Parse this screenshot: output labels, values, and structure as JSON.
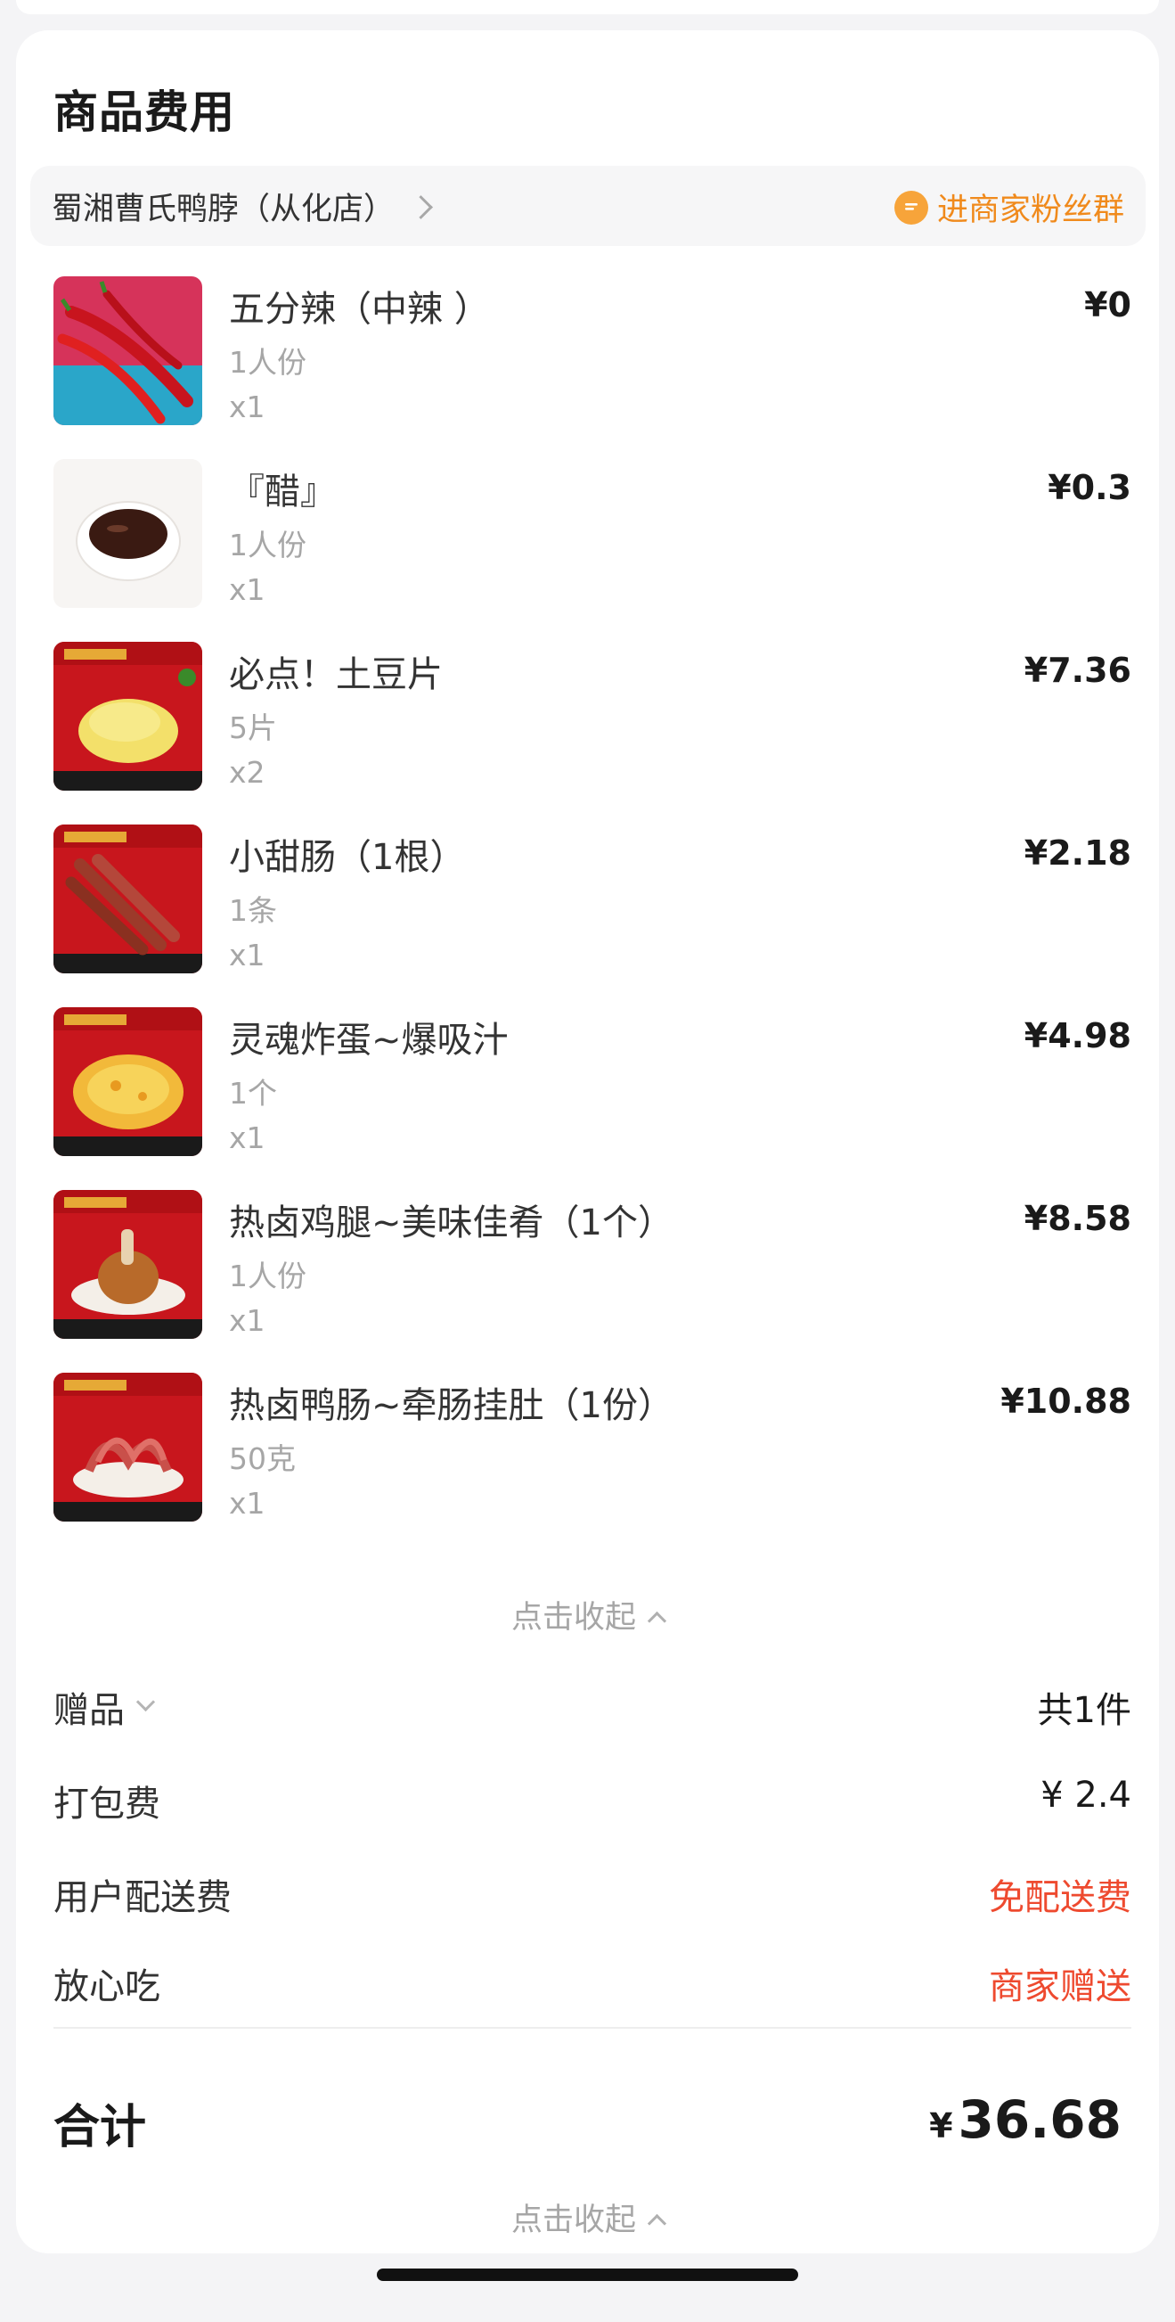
{
  "section": {
    "title": "商品费用"
  },
  "shop": {
    "name": "蜀湘曹氏鸭脖（从化店）",
    "fan_group_label": "进商家粉丝群",
    "fan_group_icon": "chat-bubble-icon",
    "accent_color": "#f08a1c"
  },
  "items": [
    {
      "name": "五分辣（中辣 ）",
      "spec": "1人份",
      "qty": "x1",
      "price": "¥0",
      "image": "chili-peppers"
    },
    {
      "name": "『醋』",
      "spec": "1人份",
      "qty": "x1",
      "price": "¥0.3",
      "image": "vinegar-dish"
    },
    {
      "name": "必点！土豆片",
      "spec": "5片",
      "qty": "x2",
      "price": "¥7.36",
      "image": "potato-slices"
    },
    {
      "name": "小甜肠（1根）",
      "spec": "1条",
      "qty": "x1",
      "price": "¥2.18",
      "image": "sausage"
    },
    {
      "name": "灵魂炸蛋~爆吸汁",
      "spec": "1个",
      "qty": "x1",
      "price": "¥4.98",
      "image": "fried-egg"
    },
    {
      "name": "热卤鸡腿~美味佳肴（1个）",
      "spec": "1人份",
      "qty": "x1",
      "price": "¥8.58",
      "image": "chicken-leg"
    },
    {
      "name": "热卤鸭肠~牵肠挂肚（1份）",
      "spec": "50克",
      "qty": "x1",
      "price": "¥10.88",
      "image": "duck-intestine"
    }
  ],
  "collapse_label": "点击收起",
  "fees": {
    "gift": {
      "label": "赠品",
      "value": "共1件"
    },
    "packing": {
      "label": "打包费",
      "value": "¥ 2.4"
    },
    "delivery": {
      "label": "用户配送费",
      "value": "免配送费"
    },
    "assurance": {
      "label": "放心吃",
      "value": "商家赠送"
    },
    "highlight_color": "#ee4a2f"
  },
  "total": {
    "label": "合计",
    "currency": "¥",
    "amount": "36.68"
  },
  "footer": {
    "collapse_label": "点击收起"
  }
}
